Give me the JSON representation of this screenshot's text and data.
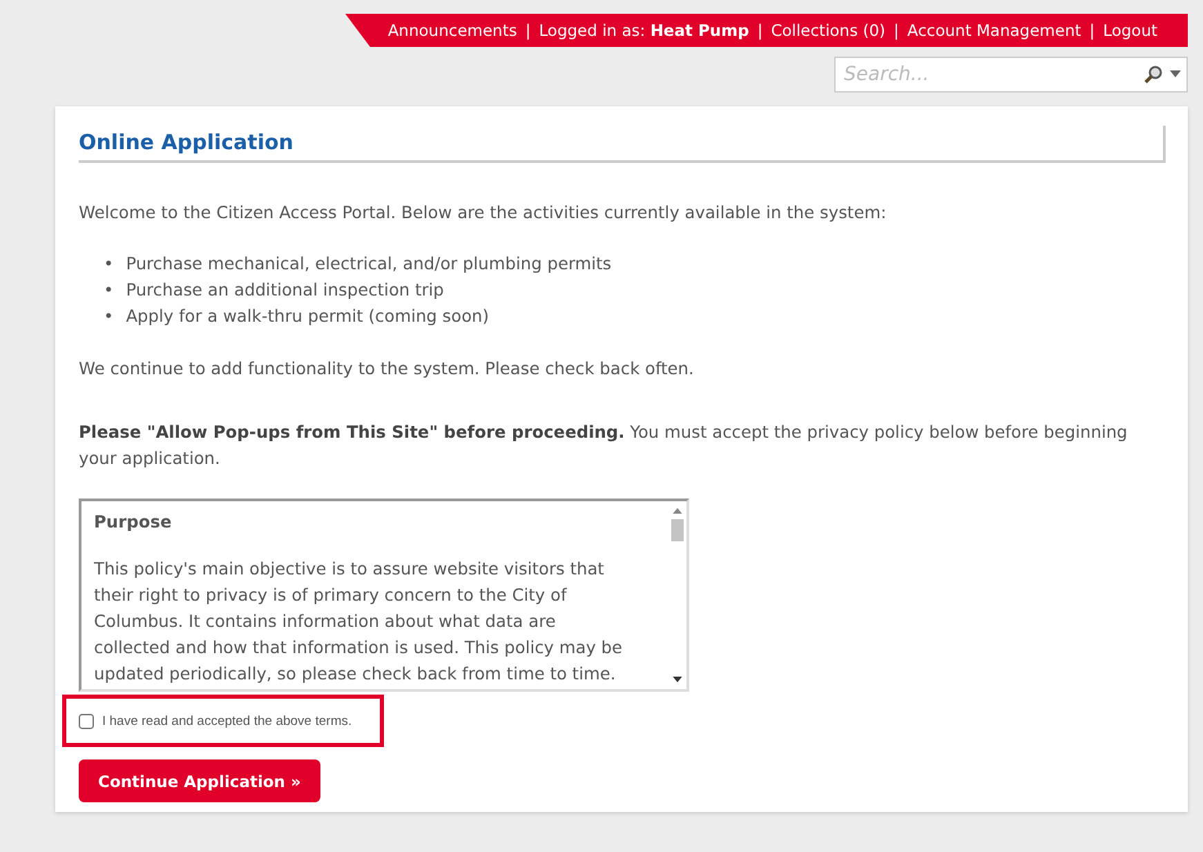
{
  "top_nav": [
    {
      "kind": "link",
      "text": "Announcements"
    },
    {
      "kind": "separator",
      "text": "|"
    },
    {
      "kind": "text",
      "text": "Logged in as: **Heat Pump**"
    },
    {
      "kind": "separator",
      "text": "|"
    },
    {
      "kind": "link",
      "text": "Collections (0)"
    },
    {
      "kind": "separator",
      "text": "|"
    },
    {
      "kind": "link",
      "text": "Account Management"
    },
    {
      "kind": "separator",
      "text": "|"
    },
    {
      "kind": "link",
      "text": "Logout"
    }
  ],
  "search": {
    "placeholder": "Search..."
  },
  "panel": {
    "title": "Online Application",
    "intro": "Welcome to the Citizen Access Portal. Below are the activities currently available in the system:",
    "activities": [
      {
        "bullet": "•",
        "text": "Purchase mechanical, electrical, and/or plumbing permits"
      },
      {
        "bullet": "•",
        "text": "Purchase an additional inspection trip"
      },
      {
        "bullet": "•",
        "text": "Apply for a walk-thru permit (coming soon)"
      }
    ],
    "note": "We continue to add functionality to the system. Please check back often.",
    "notice": "**Please \"Allow Pop-ups from This Site\" before proceeding.** You must accept the privacy policy below before beginning your application.",
    "policy": {
      "heading": "Purpose",
      "text": "This policy's main objective is to assure website visitors that their right to privacy is of primary concern to the City of Columbus. It contains information about what data are collected and how that information is used. This policy may be updated periodically, so please check back from time to time."
    },
    "terms": {
      "label": "I have read and accepted the above terms.",
      "checked": false,
      "highlighted": true
    },
    "button": "Continue Application »"
  }
}
